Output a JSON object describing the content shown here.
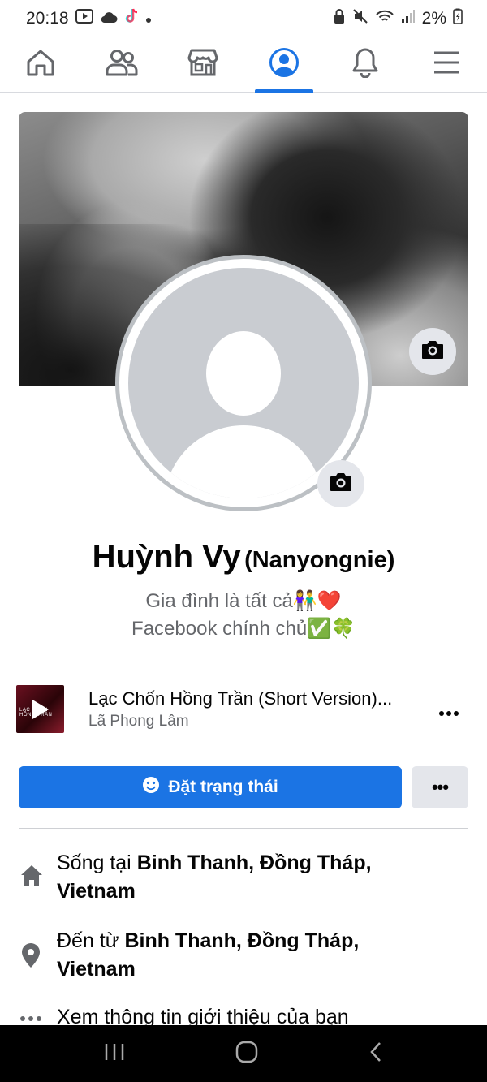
{
  "status_bar": {
    "time": "20:18",
    "battery": "2%"
  },
  "nav": {
    "tabs": [
      {
        "name": "home-tab",
        "icon": "home-icon"
      },
      {
        "name": "friends-tab",
        "icon": "friends-icon"
      },
      {
        "name": "marketplace-tab",
        "icon": "marketplace-icon"
      },
      {
        "name": "profile-tab",
        "icon": "profile-icon",
        "active": true
      },
      {
        "name": "notifications-tab",
        "icon": "bell-icon"
      },
      {
        "name": "menu-tab",
        "icon": "menu-icon"
      }
    ],
    "active_color": "#1b74e4"
  },
  "profile": {
    "name": "Huỳnh Vy",
    "alternate_name": "(Nanyongnie)",
    "bio_line_1": "Gia đình là tất cả👫❤️",
    "bio_line_2": "Facebook chính chủ✅🍀"
  },
  "music": {
    "title": "Lạc Chốn Hồng Trần (Short Version)...",
    "artist": "Lã Phong Lâm",
    "art_text": "LẠC CHỐN HỒNG TRẦN"
  },
  "actions": {
    "status_button": "Đặt trạng thái",
    "more_button": "•••"
  },
  "info": {
    "lives_prefix": "Sống tại ",
    "lives_place": "Binh Thanh, Đồng Tháp, Vietnam",
    "from_prefix": "Đến từ ",
    "from_place": "Binh Thanh, Đồng Tháp, Vietnam",
    "see_about": "Xem thông tin giới thiệu của bạn"
  },
  "colors": {
    "brand_blue": "#1b74e4",
    "secondary_text": "#65676b",
    "button_grey": "#e4e6eb"
  }
}
